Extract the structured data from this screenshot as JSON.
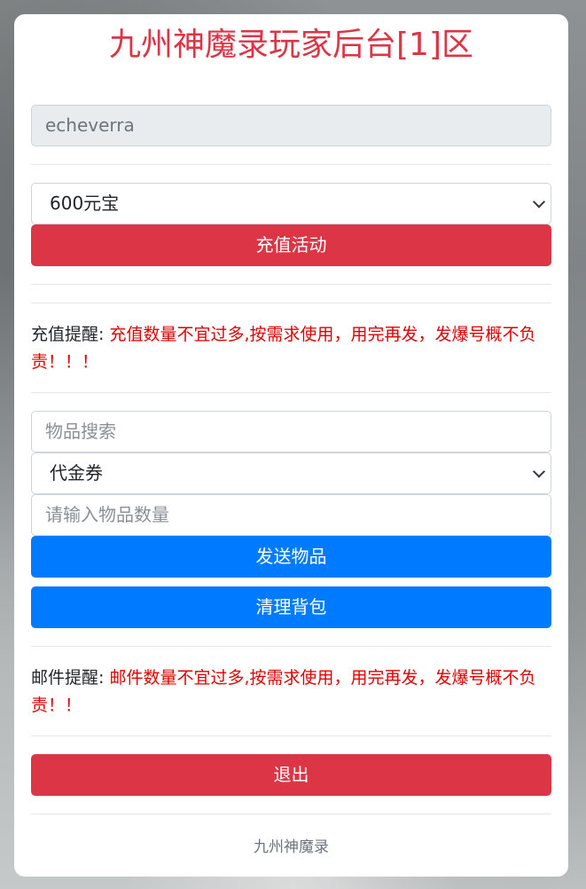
{
  "header": {
    "title": "九州神魔录玩家后台[1]区"
  },
  "account": {
    "username": "echeverra"
  },
  "recharge": {
    "selected_option": "600元宝",
    "button_label": "充值活动",
    "notice_label": "充值提醒:",
    "notice_text": "充值数量不宜过多,按需求使用，用完再发，发爆号概不负责！！！"
  },
  "items": {
    "search_placeholder": "物品搜索",
    "selected_item": "代金券",
    "quantity_placeholder": "请输入物品数量",
    "send_label": "发送物品",
    "clear_label": "清理背包"
  },
  "mail": {
    "notice_label": "邮件提醒:",
    "notice_text": "邮件数量不宜过多,按需求使用，用完再发，发爆号概不负责！！"
  },
  "logout": {
    "label": "退出"
  },
  "footer": {
    "text": "九州神魔录"
  },
  "colors": {
    "danger": "#dc3545",
    "primary": "#007bff",
    "warning_text": "#e00000"
  }
}
